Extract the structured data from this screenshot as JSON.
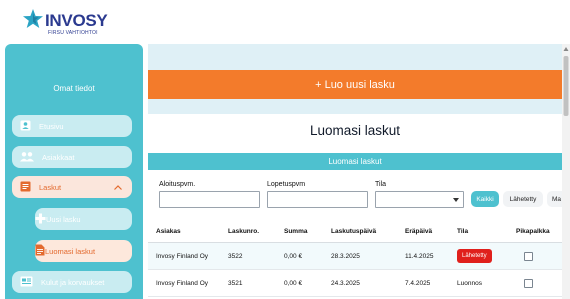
{
  "brand": {
    "name": "INVOSY",
    "tagline": "FIRSU VAHTIOHTOI",
    "star_color": "#2aa3c4",
    "text_color": "#2b3a8f"
  },
  "sidebar": {
    "heading": "Omat tiedot",
    "items": [
      {
        "label": "Etusivu",
        "icon": "user-icon"
      },
      {
        "label": "Asiakkaat",
        "icon": "users-icon"
      },
      {
        "label": "Laskut",
        "icon": "invoice-icon",
        "active": true,
        "icon_right": "chevron-up-icon"
      },
      {
        "label": "Kulut ja korvaukset",
        "icon": "receipt-icon"
      }
    ],
    "subitems": [
      {
        "label": "Uusi lasku",
        "icon": "plus-icon"
      },
      {
        "label": "Luomasi laskut",
        "icon": "document-icon",
        "current": true
      }
    ],
    "color": "#4ec1cf"
  },
  "main": {
    "cta_label": "+ Luo uusi lasku",
    "cta_color": "#f37b2b",
    "page_title": "Luomasi laskut",
    "section_header": "Luomasi laskut",
    "filters": {
      "start_label": "Aloituspvm.",
      "start_value": "",
      "end_label": "Lopetuspvm",
      "end_value": "",
      "status_label": "Tila",
      "status_value": "",
      "buttons": [
        "Kaikki",
        "Lähetetty",
        "Ma"
      ]
    },
    "table": {
      "columns": [
        "Asiakas",
        "Laskunro.",
        "Summa",
        "Laskutuspäivä",
        "Eräpäivä",
        "Tila",
        "Pikapalkka"
      ],
      "rows": [
        {
          "customer": "Invosy Finland Oy",
          "number": "3522",
          "amount": "0,00 €",
          "invoice_date": "28.3.2025",
          "due_date": "11.4.2025",
          "status": "Lähetetty",
          "status_badge": true,
          "quick_pay": false
        },
        {
          "customer": "Invosy Finland Oy",
          "number": "3521",
          "amount": "0,00 €",
          "invoice_date": "24.3.2025",
          "due_date": "7.4.2025",
          "status": "Luonnos",
          "status_badge": false,
          "quick_pay": false
        }
      ]
    }
  }
}
